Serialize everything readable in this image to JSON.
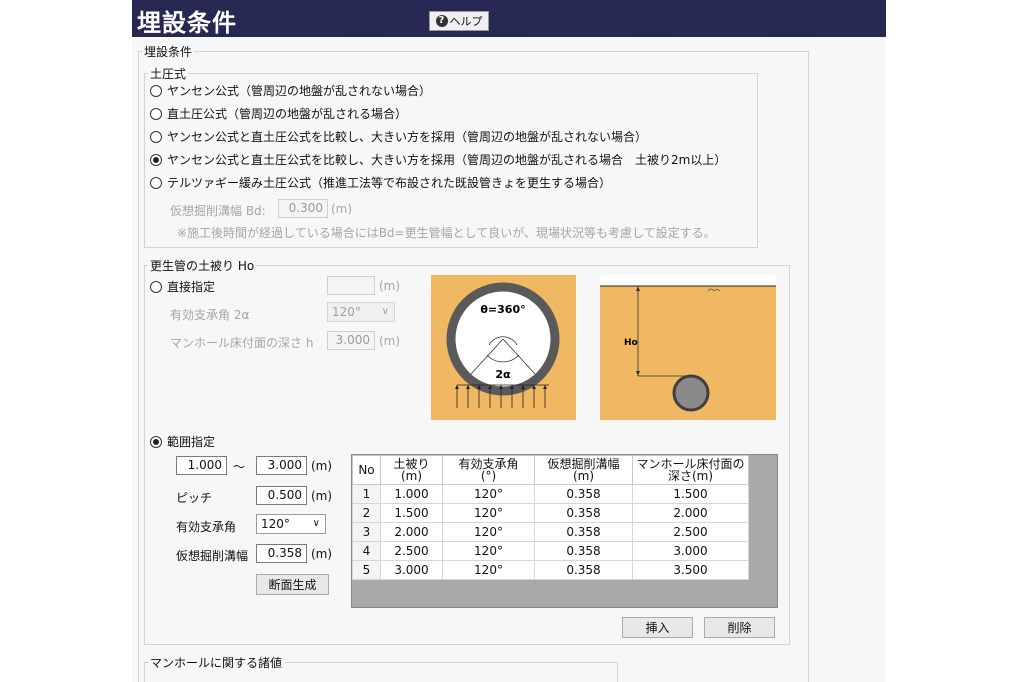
{
  "title": "埋設条件",
  "help_label": "ヘルプ",
  "conditions_group": "埋設条件",
  "earth_pressure": {
    "legend": "土圧式",
    "options": [
      "ヤンセン公式（管周辺の地盤が乱されない場合）",
      "直土圧公式（管周辺の地盤が乱される場合）",
      "ヤンセン公式と直土圧公式を比較し、大きい方を採用（管周辺の地盤が乱されない場合）",
      "ヤンセン公式と直土圧公式を比較し、大きい方を採用（管周辺の地盤が乱される場合　土被り2m以上）",
      "テルツァギー緩み土圧公式（推進工法等で布設された既設管きょを更生する場合）"
    ],
    "selected_index": 3,
    "bd_label": "仮想掘削溝幅 Bd:",
    "bd_value": "0.300",
    "bd_unit": "(m)",
    "note": "※施工後時間が経過している場合にはBd=更生管幅として良いが、現場状況等も考慮して設定する。"
  },
  "cover": {
    "legend": "更生管の土被り Ho",
    "direct_label": "直接指定",
    "direct_value": "",
    "direct_unit": "(m)",
    "angle_label": "有効支承角 2α",
    "angle_value": "120°",
    "depth_label": "マンホール床付面の深さ h",
    "depth_value": "3.000",
    "depth_unit": "(m)",
    "range_label": "範囲指定",
    "range_from": "1.000",
    "range_sep": "～",
    "range_to": "3.000",
    "range_unit": "(m)",
    "pitch_label": "ピッチ",
    "pitch_value": "0.500",
    "pitch_unit": "(m)",
    "range_angle_label": "有効支承角",
    "range_angle_value": "120°",
    "trench_label": "仮想掘削溝幅",
    "trench_value": "0.358",
    "trench_unit": "(m)",
    "generate_btn": "断面生成",
    "diagram_theta": "θ=360°",
    "diagram_alpha": "2α",
    "diagram_ho": "Ho"
  },
  "table": {
    "headers": [
      "No",
      "土被り\n(m)",
      "有効支承角\n(°)",
      "仮想掘削溝幅\n(m)",
      "マンホール床付面の\n深さ(m)"
    ],
    "rows": [
      [
        "1",
        "1.000",
        "120°",
        "0.358",
        "1.500"
      ],
      [
        "2",
        "1.500",
        "120°",
        "0.358",
        "2.000"
      ],
      [
        "3",
        "2.000",
        "120°",
        "0.358",
        "2.500"
      ],
      [
        "4",
        "2.500",
        "120°",
        "0.358",
        "3.000"
      ],
      [
        "5",
        "3.000",
        "120°",
        "0.358",
        "3.500"
      ]
    ]
  },
  "insert_btn": "挿入",
  "delete_btn": "削除",
  "manhole_group": "マンホールに関する諸値",
  "colors": {
    "titlebar": "#23244f",
    "soil": "#f0b862",
    "pipe": "#555555"
  }
}
